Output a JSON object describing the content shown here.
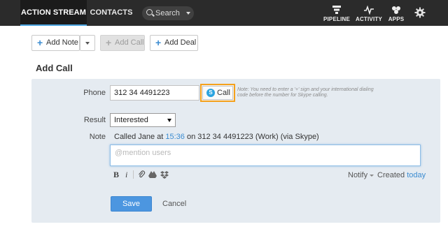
{
  "nav": {
    "tabs": [
      {
        "label": "ACTION STREAM",
        "active": true
      },
      {
        "label": "CONTACTS",
        "active": false
      }
    ],
    "search_label": "Search",
    "tools": [
      {
        "label": "PIPELINE",
        "icon": "pipeline-icon"
      },
      {
        "label": "ACTIVITY",
        "icon": "activity-icon"
      },
      {
        "label": "APPS",
        "icon": "apps-icon"
      }
    ],
    "settings_icon": "gear-icon"
  },
  "actions": {
    "add_note": "Add Note",
    "add_call": "Add Call",
    "add_deal": "Add Deal"
  },
  "form": {
    "heading": "Add Call",
    "phone_label": "Phone",
    "phone_value": "312 34 4491223",
    "call_button": "Call",
    "phone_hint": "Note: You need to enter a '+' sign and your international dialing code before the number for Skype calling.",
    "result_label": "Result",
    "result_value": "Interested",
    "note_label": "Note",
    "note_prefix": "Called Jane at",
    "note_time": "15:36",
    "note_suffix": "on 312 34 4491223 (Work) (via Skype)",
    "textarea_placeholder": "@mention users",
    "format_bold": "B",
    "format_italic": "i",
    "notify_label": "Notify",
    "created_label": "Created",
    "created_value": "today",
    "save_label": "Save",
    "cancel_label": "Cancel"
  },
  "colors": {
    "topbar": "#2b2b2b",
    "accent": "#3b8cd1",
    "panel": "#e5ebf1",
    "highlight": "#f5a11c",
    "save": "#4c96e0"
  }
}
